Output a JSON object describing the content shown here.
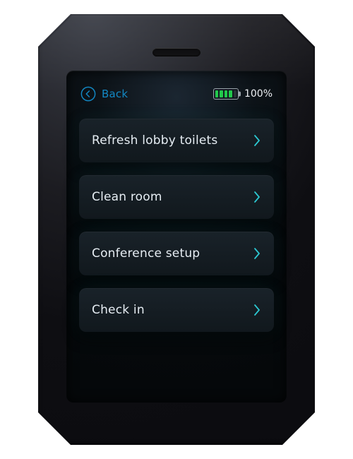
{
  "colors": {
    "accent": "#2cc8d2",
    "back_link": "#1288c4"
  },
  "header": {
    "back_label": "Back",
    "battery": {
      "percent_label": "100%",
      "bars_filled": 4,
      "bars_total": 5
    }
  },
  "tasks": [
    {
      "label": "Refresh lobby toilets"
    },
    {
      "label": "Clean room"
    },
    {
      "label": "Conference setup"
    },
    {
      "label": "Check in"
    }
  ]
}
